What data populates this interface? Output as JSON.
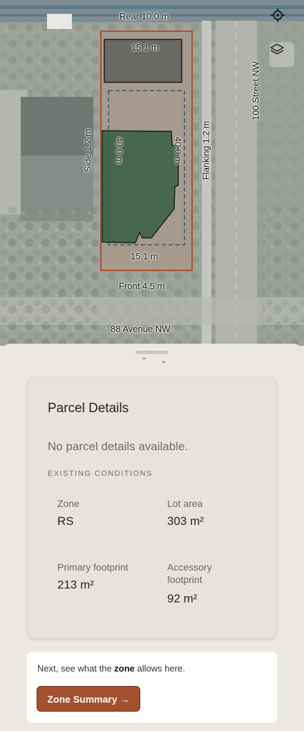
{
  "map": {
    "rear_label": "Rear 10.0 m",
    "front_label": "Front 4.5 m",
    "side_label": "Side 1.2 m",
    "flanking_label": "Flanking 1.2 m",
    "accessory_width": "15.1 m",
    "lot_width_bottom": "15.1 m",
    "primary_depth": "40.0 m",
    "primary_depth_right": "40.0 m",
    "street_east": "100 Street NW",
    "street_south": "88 Avenue NW",
    "icons": [
      "locate-icon",
      "layers-icon"
    ]
  },
  "sheet": {
    "expand_hint": "⌃ ⌄"
  },
  "parcel": {
    "title": "Parcel Details",
    "no_details": "No parcel details available.",
    "section_label": "EXISTING CONDITIONS",
    "zone_label": "Zone",
    "zone_value": "RS",
    "lot_area_label": "Lot area",
    "lot_area_value": "303 m²",
    "primary_label": "Primary footprint",
    "primary_value": "213 m²",
    "accessory_label_1": "Accessory",
    "accessory_label_2": "footprint",
    "accessory_value": "92 m²"
  },
  "next": {
    "prefix": "Next, see what the ",
    "bold": "zone",
    "suffix": " allows here.",
    "button_label": "Zone Summary →"
  },
  "colors": {
    "lot_outline": "#a8502f",
    "building_fill": "#2f5a3c",
    "accent_button": "#a3502f"
  }
}
